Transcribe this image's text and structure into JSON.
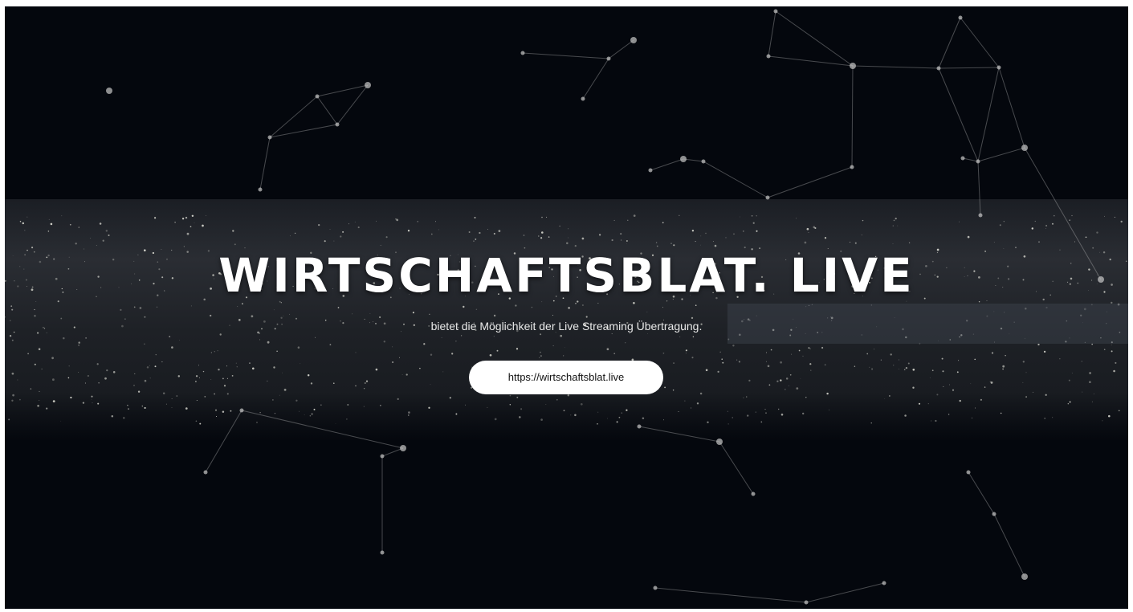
{
  "hero": {
    "title": "WIRTSCHAFTSBLAT. LIVE",
    "subtitle": "bietet die Möglichkeit der Live Streaming Übertragung.",
    "cta_label": "https://wirtschaftsblat.live"
  },
  "colors": {
    "background": "#04070d",
    "text": "#ffffff",
    "button_bg": "#ffffff",
    "button_text": "#111111"
  }
}
